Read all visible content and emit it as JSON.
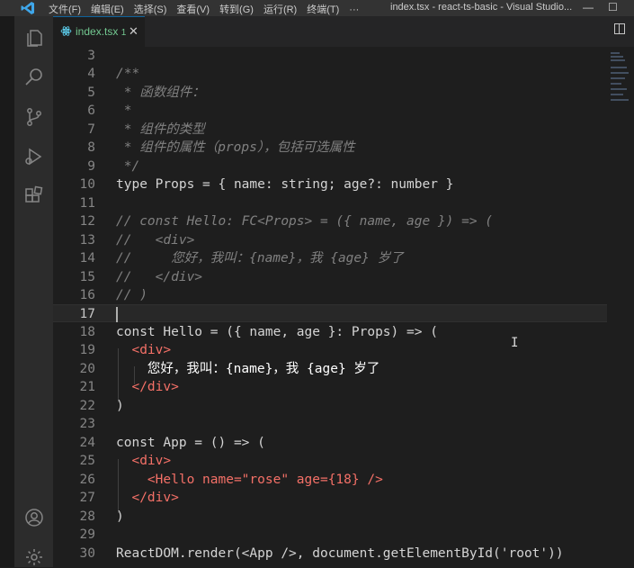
{
  "titlebar": {
    "menu": [
      "文件(F)",
      "编辑(E)",
      "选择(S)",
      "查看(V)",
      "转到(G)",
      "运行(R)",
      "终端(T)",
      "···"
    ],
    "window_title": "index.tsx - react-ts-basic - Visual Studio...",
    "minimize": "—",
    "maximize": "☐"
  },
  "tab": {
    "filename": "index.tsx",
    "badge": "1",
    "close": "✕"
  },
  "activity_icons": [
    "explorer-icon",
    "search-icon",
    "source-control-icon",
    "run-debug-icon",
    "extensions-icon",
    "account-icon",
    "manage-gear-icon"
  ],
  "editor": {
    "current_line": 17,
    "lines": [
      {
        "n": "3"
      },
      {
        "n": "4",
        "t": "/**"
      },
      {
        "n": "5",
        "t": " * 函数组件："
      },
      {
        "n": "6",
        "t": " *"
      },
      {
        "n": "7",
        "t": " * 组件的类型"
      },
      {
        "n": "8",
        "t": " * 组件的属性（props），包括可选属性"
      },
      {
        "n": "9",
        "t": " */"
      },
      {
        "n": "10",
        "t": "type Props = { name: string; age?: number }"
      },
      {
        "n": "11"
      },
      {
        "n": "12",
        "t": "// const Hello: FC<Props> = ({ name, age }) => ("
      },
      {
        "n": "13",
        "t": "//   <div>"
      },
      {
        "n": "14",
        "t": "//     您好，我叫：{name}，我 {age} 岁了"
      },
      {
        "n": "15",
        "t": "//   </div>"
      },
      {
        "n": "16",
        "t": "// )"
      },
      {
        "n": "17"
      },
      {
        "n": "18",
        "t": "const Hello = ({ name, age }: Props) => ("
      },
      {
        "n": "19",
        "t": "  <div>"
      },
      {
        "n": "20",
        "t": "    您好，我叫：{name}，我 {age} 岁了"
      },
      {
        "n": "21",
        "t": "  </div>"
      },
      {
        "n": "22",
        "t": ")"
      },
      {
        "n": "23"
      },
      {
        "n": "24",
        "t": "const App = () => ("
      },
      {
        "n": "25",
        "t": "  <div>"
      },
      {
        "n": "26",
        "t": "    <Hello name=\"rose\" age={18} />"
      },
      {
        "n": "27",
        "t": "  </div>"
      },
      {
        "n": "28",
        "t": ")"
      },
      {
        "n": "29"
      },
      {
        "n": "30",
        "t": "ReactDOM.render(<App />, document.getElementById('root'))"
      }
    ]
  }
}
